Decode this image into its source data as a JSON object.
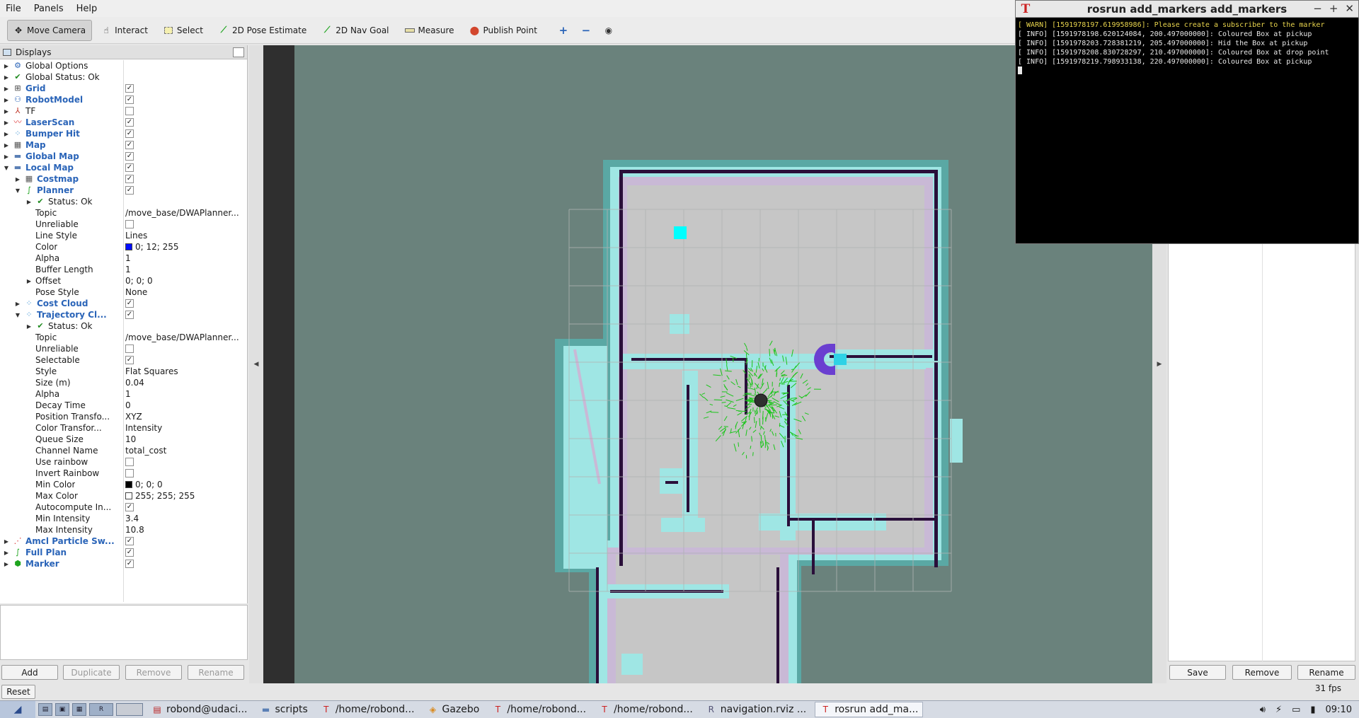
{
  "menu": [
    "File",
    "Panels",
    "Help"
  ],
  "toolbar": {
    "move_camera": "Move Camera",
    "interact": "Interact",
    "select": "Select",
    "pose_estimate": "2D Pose Estimate",
    "nav_goal": "2D Nav Goal",
    "measure": "Measure",
    "publish_point": "Publish Point"
  },
  "displays": {
    "title": "Displays",
    "rows": [
      {
        "depth": 0,
        "arrow": "right",
        "icon": "gear-icon",
        "label": "Global Options",
        "blue": false
      },
      {
        "depth": 0,
        "arrow": "right",
        "icon": "check-icon",
        "label": "Global Status: Ok",
        "blue": false
      },
      {
        "depth": 0,
        "arrow": "right",
        "icon": "grid-icon",
        "label": "Grid",
        "blue": true,
        "check": true
      },
      {
        "depth": 0,
        "arrow": "right",
        "icon": "robot-icon",
        "label": "RobotModel",
        "blue": true,
        "check": true
      },
      {
        "depth": 0,
        "arrow": "right",
        "icon": "tf-icon",
        "label": "TF",
        "blue": false,
        "check": false
      },
      {
        "depth": 0,
        "arrow": "right",
        "icon": "laser-icon",
        "label": "LaserScan",
        "blue": true,
        "check": true
      },
      {
        "depth": 0,
        "arrow": "right",
        "icon": "dots-icon",
        "label": "Bumper Hit",
        "blue": true,
        "check": true
      },
      {
        "depth": 0,
        "arrow": "right",
        "icon": "map-icon",
        "label": "Map",
        "blue": true,
        "check": true
      },
      {
        "depth": 0,
        "arrow": "right",
        "icon": "folder-icon",
        "label": "Global Map",
        "blue": true,
        "check": true
      },
      {
        "depth": 0,
        "arrow": "down",
        "icon": "folder-icon",
        "label": "Local Map",
        "blue": true,
        "check": true
      },
      {
        "depth": 1,
        "arrow": "right",
        "icon": "map-icon",
        "label": "Costmap",
        "blue": true,
        "check": true
      },
      {
        "depth": 1,
        "arrow": "down",
        "icon": "path-icon",
        "label": "Planner",
        "blue": true,
        "check": true
      },
      {
        "depth": 2,
        "arrow": "right",
        "icon": "check-icon",
        "label": "Status: Ok",
        "blue": false
      },
      {
        "depth": 2,
        "label": "Topic",
        "value": "/move_base/DWAPlanner..."
      },
      {
        "depth": 2,
        "label": "Unreliable",
        "check": false
      },
      {
        "depth": 2,
        "label": "Line Style",
        "value": "Lines"
      },
      {
        "depth": 2,
        "label": "Color",
        "value": "0; 12; 255",
        "swatch": "#000cff"
      },
      {
        "depth": 2,
        "label": "Alpha",
        "value": "1"
      },
      {
        "depth": 2,
        "label": "Buffer Length",
        "value": "1"
      },
      {
        "depth": 2,
        "arrow": "right",
        "label": "Offset",
        "value": "0; 0; 0"
      },
      {
        "depth": 2,
        "label": "Pose Style",
        "value": "None"
      },
      {
        "depth": 1,
        "arrow": "right",
        "icon": "dots-icon",
        "label": "Cost Cloud",
        "blue": true,
        "check": true
      },
      {
        "depth": 1,
        "arrow": "down",
        "icon": "dots-icon",
        "label": "Trajectory Cl...",
        "blue": true,
        "check": true
      },
      {
        "depth": 2,
        "arrow": "right",
        "icon": "check-icon",
        "label": "Status: Ok",
        "blue": false
      },
      {
        "depth": 2,
        "label": "Topic",
        "value": "/move_base/DWAPlanner..."
      },
      {
        "depth": 2,
        "label": "Unreliable",
        "check": false
      },
      {
        "depth": 2,
        "label": "Selectable",
        "check": true
      },
      {
        "depth": 2,
        "label": "Style",
        "value": "Flat Squares"
      },
      {
        "depth": 2,
        "label": "Size (m)",
        "value": "0.04"
      },
      {
        "depth": 2,
        "label": "Alpha",
        "value": "1"
      },
      {
        "depth": 2,
        "label": "Decay Time",
        "value": "0"
      },
      {
        "depth": 2,
        "label": "Position Transfo...",
        "value": "XYZ"
      },
      {
        "depth": 2,
        "label": "Color Transfor...",
        "value": "Intensity"
      },
      {
        "depth": 2,
        "label": "Queue Size",
        "value": "10"
      },
      {
        "depth": 2,
        "label": "Channel Name",
        "value": "total_cost"
      },
      {
        "depth": 2,
        "label": "Use rainbow",
        "check": false
      },
      {
        "depth": 2,
        "label": "Invert Rainbow",
        "check": false
      },
      {
        "depth": 2,
        "label": "Min Color",
        "value": "0; 0; 0",
        "swatch": "#000000"
      },
      {
        "depth": 2,
        "label": "Max Color",
        "value": "255; 255; 255",
        "swatch": "#ffffff"
      },
      {
        "depth": 2,
        "label": "Autocompute In...",
        "check": true
      },
      {
        "depth": 2,
        "label": "Min Intensity",
        "value": "3.4"
      },
      {
        "depth": 2,
        "label": "Max Intensity",
        "value": "10.8"
      },
      {
        "depth": 0,
        "arrow": "right",
        "icon": "particles-icon",
        "label": "Amcl Particle Sw...",
        "blue": true,
        "check": true
      },
      {
        "depth": 0,
        "arrow": "right",
        "icon": "path-icon",
        "label": "Full Plan",
        "blue": true,
        "check": true
      },
      {
        "depth": 0,
        "arrow": "right",
        "icon": "marker-icon",
        "label": "Marker",
        "blue": true,
        "check": true
      }
    ],
    "buttons": {
      "add": "Add",
      "duplicate": "Duplicate",
      "remove": "Remove",
      "rename": "Rename"
    },
    "reset": "Reset"
  },
  "views_panel": {
    "save": "Save",
    "remove": "Remove",
    "rename": "Rename"
  },
  "fps": "31 fps",
  "terminal": {
    "title": "rosrun add_markers add_markers",
    "lines": [
      {
        "text": "[ WARN] [1591978197.619958986]: Please create a subscriber to the marker",
        "warn": true
      },
      {
        "text": "[ INFO] [1591978198.620124084, 200.497000000]: Coloured Box at pickup",
        "warn": false
      },
      {
        "text": "[ INFO] [1591978203.728381219, 205.497000000]: Hid the Box at pickup",
        "warn": false
      },
      {
        "text": "[ INFO] [1591978208.830728297, 210.497000000]: Coloured Box at drop point",
        "warn": false
      },
      {
        "text": "[ INFO] [1591978219.798933138, 220.497000000]: Coloured Box at pickup",
        "warn": false
      }
    ]
  },
  "taskbar": {
    "tasks": [
      {
        "label": "robond@udaci...",
        "icon": "terminal-icon"
      },
      {
        "label": "scripts",
        "icon": "folder-icon"
      },
      {
        "label": "/home/robond...",
        "icon": "xterm-icon"
      },
      {
        "label": "Gazebo",
        "icon": "gazebo-icon"
      },
      {
        "label": "/home/robond...",
        "icon": "xterm-icon"
      },
      {
        "label": "/home/robond...",
        "icon": "xterm-icon"
      },
      {
        "label": "navigation.rviz ...",
        "icon": "rviz-icon"
      },
      {
        "label": "rosrun add_ma...",
        "icon": "xterm-icon",
        "active": true
      }
    ],
    "clock": "09:10"
  },
  "colors": {
    "view_bg": "#6a827c",
    "free_space": "#c6c6c6",
    "inflation_cyan": "#9fe6e4",
    "inflation_teal": "#5aa8a4",
    "obstacle": "#2a0f3a",
    "trajectories": "#19c519",
    "marker": "#00ffff"
  }
}
